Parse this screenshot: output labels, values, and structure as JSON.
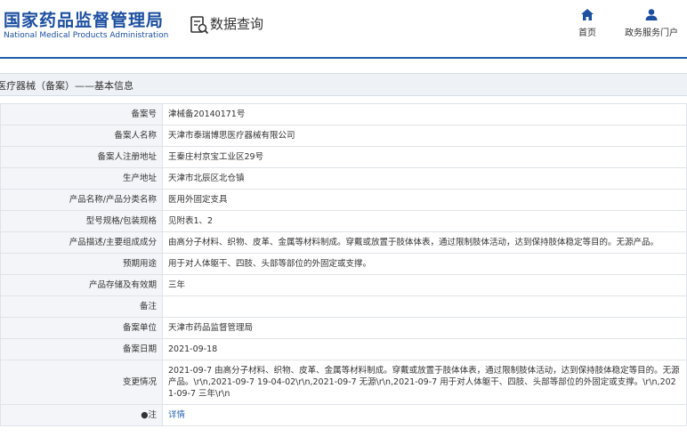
{
  "header": {
    "logo_cn": "国家药品监督管理局",
    "logo_en": "National Medical Products Administration",
    "query_label": "数据查询",
    "nav": [
      {
        "label": "首页",
        "icon": "home-icon"
      },
      {
        "label": "政务服务门户",
        "icon": "user-icon"
      }
    ]
  },
  "title": "医疗器械（备案）——基本信息",
  "rows": [
    {
      "label": "备案号",
      "value": "津械备20140171号"
    },
    {
      "label": "备案人名称",
      "value": "天津市泰瑞博思医疗器械有限公司"
    },
    {
      "label": "备案人注册地址",
      "value": "王秦庄村京宝工业区29号"
    },
    {
      "label": "生产地址",
      "value": "天津市北辰区北仓镇"
    },
    {
      "label": "产品名称/产品分类名称",
      "value": "医用外固定支具"
    },
    {
      "label": "型号规格/包装规格",
      "value": "见附表1、2"
    },
    {
      "label": "产品描述/主要组成成分",
      "value": "由高分子材料、织物、皮革、金属等材料制成。穿戴或放置于肢体体表，通过限制肢体活动，达到保持肢体稳定等目的。无源产品。"
    },
    {
      "label": "预期用途",
      "value": "用于对人体躯干、四肢、头部等部位的外固定或支撑。"
    },
    {
      "label": "产品存储及有效期",
      "value": "三年"
    },
    {
      "label": "备注",
      "value": ""
    },
    {
      "label": "备案单位",
      "value": "天津市药品监督管理局"
    },
    {
      "label": "备案日期",
      "value": "2021-09-18"
    },
    {
      "label": "变更情况",
      "value": "2021-09-7 由高分子材料、织物、皮革、金属等材料制成。穿戴或放置于肢体体表，通过限制肢体活动，达到保持肢体稳定等目的。无源产品。\\r\\n,2021-09-7 19-04-02\\r\\n,2021-09-7 无源\\r\\n,2021-09-7 用于对人体躯干、四肢、头部等部位的外固定或支撑。\\r\\n,2021-09-7 三年\\r\\n"
    },
    {
      "label": "●注",
      "value": "详情"
    }
  ]
}
